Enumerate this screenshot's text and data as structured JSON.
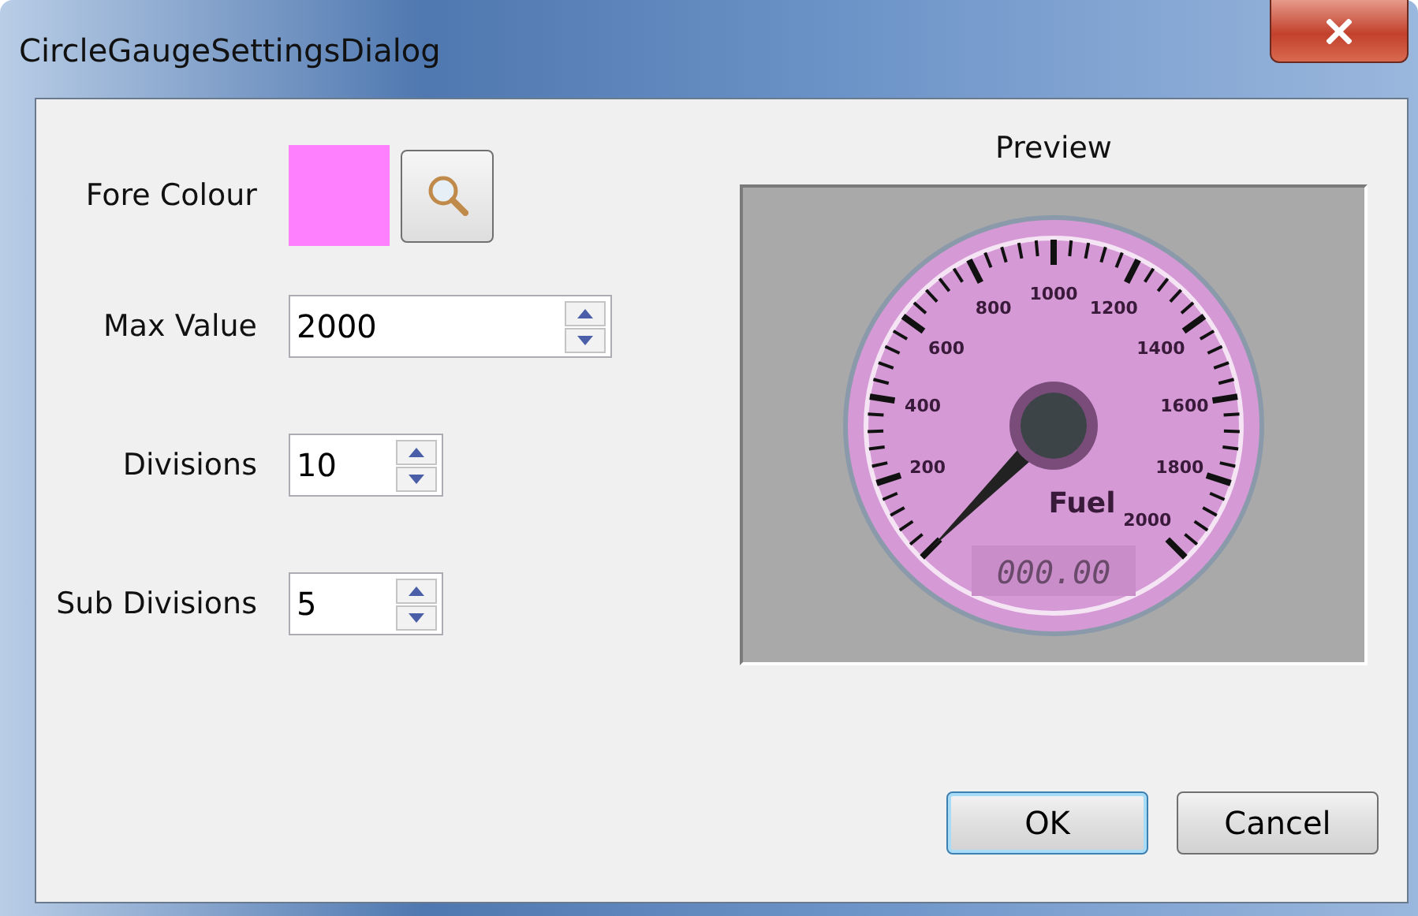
{
  "window": {
    "title": "CircleGaugeSettingsDialog"
  },
  "fore_colour": {
    "label": "Fore Colour",
    "color": "#ff80ff"
  },
  "fields": [
    {
      "label": "Max Value",
      "value": "2000",
      "kind": "wide"
    },
    {
      "label": "Divisions",
      "value": "10",
      "kind": "narrow"
    },
    {
      "label": "Sub Divisions",
      "value": "5",
      "kind": "narrow"
    }
  ],
  "preview": {
    "title": "Preview",
    "gauge": {
      "name": "Fuel",
      "readout": "000.00",
      "labels": [
        "200",
        "400",
        "600",
        "800",
        "1000",
        "1200",
        "1400",
        "1600",
        "1800",
        "2000"
      ]
    }
  },
  "buttons": [
    {
      "label": "OK",
      "default": true
    },
    {
      "label": "Cancel",
      "default": false
    }
  ]
}
